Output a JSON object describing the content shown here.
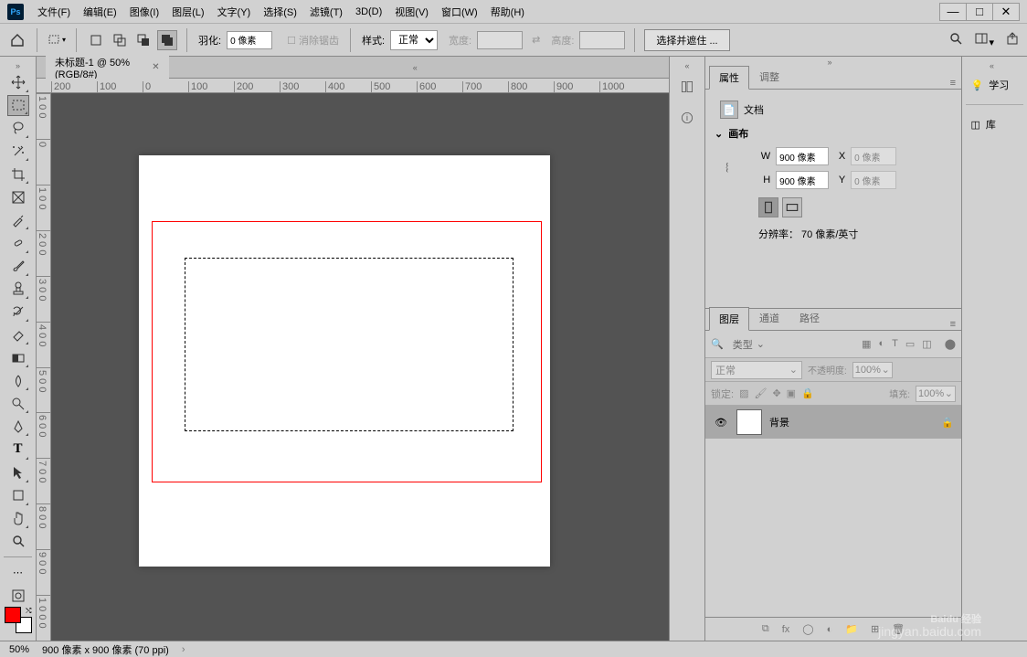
{
  "menus": [
    "文件(F)",
    "编辑(E)",
    "图像(I)",
    "图层(L)",
    "文字(Y)",
    "选择(S)",
    "滤镜(T)",
    "3D(D)",
    "视图(V)",
    "窗口(W)",
    "帮助(H)"
  ],
  "toolbar": {
    "feather_label": "羽化:",
    "feather_value": "0 像素",
    "antialias": "消除锯齿",
    "style_label": "样式:",
    "style_value": "正常",
    "width_label": "宽度:",
    "height_label": "高度:",
    "select_mask": "选择并遮住 ..."
  },
  "doc_tab": "未标题-1 @ 50%(RGB/8#)",
  "ruler_h": [
    "200",
    "100",
    "0",
    "100",
    "200",
    "300",
    "400",
    "500",
    "600",
    "700",
    "800",
    "900",
    "1000"
  ],
  "ruler_v": [
    "1 0 0",
    "0",
    "1 0 0",
    "2 0 0",
    "3 0 0",
    "4 0 0",
    "5 0 0",
    "6 0 0",
    "7 0 0",
    "8 0 0",
    "9 0 0",
    "1 0 0 0"
  ],
  "panels": {
    "properties": "属性",
    "adjustments": "调整",
    "document": "文档",
    "canvas": "画布",
    "W": "W",
    "H": "H",
    "X": "X",
    "Y": "Y",
    "w_val": "900 像素",
    "h_val": "900 像素",
    "x_val": "0 像素",
    "y_val": "0 像素",
    "resolution": "分辨率： 70 像素/英寸",
    "layers": "图层",
    "channels": "通道",
    "paths": "路径",
    "kind": "类型",
    "blend": "正常",
    "opacity_label": "不透明度:",
    "opacity_val": "100%",
    "lock_label": "锁定:",
    "fill_label": "填充:",
    "fill_val": "100%",
    "bg_layer": "背景",
    "learn": "学习",
    "library": "库"
  },
  "status": {
    "zoom": "50%",
    "docinfo": "900 像素 x 900 像素 (70 ppi)"
  },
  "watermark": {
    "main": "Baidu 经验",
    "sub": "jingyan.baidu.com"
  }
}
